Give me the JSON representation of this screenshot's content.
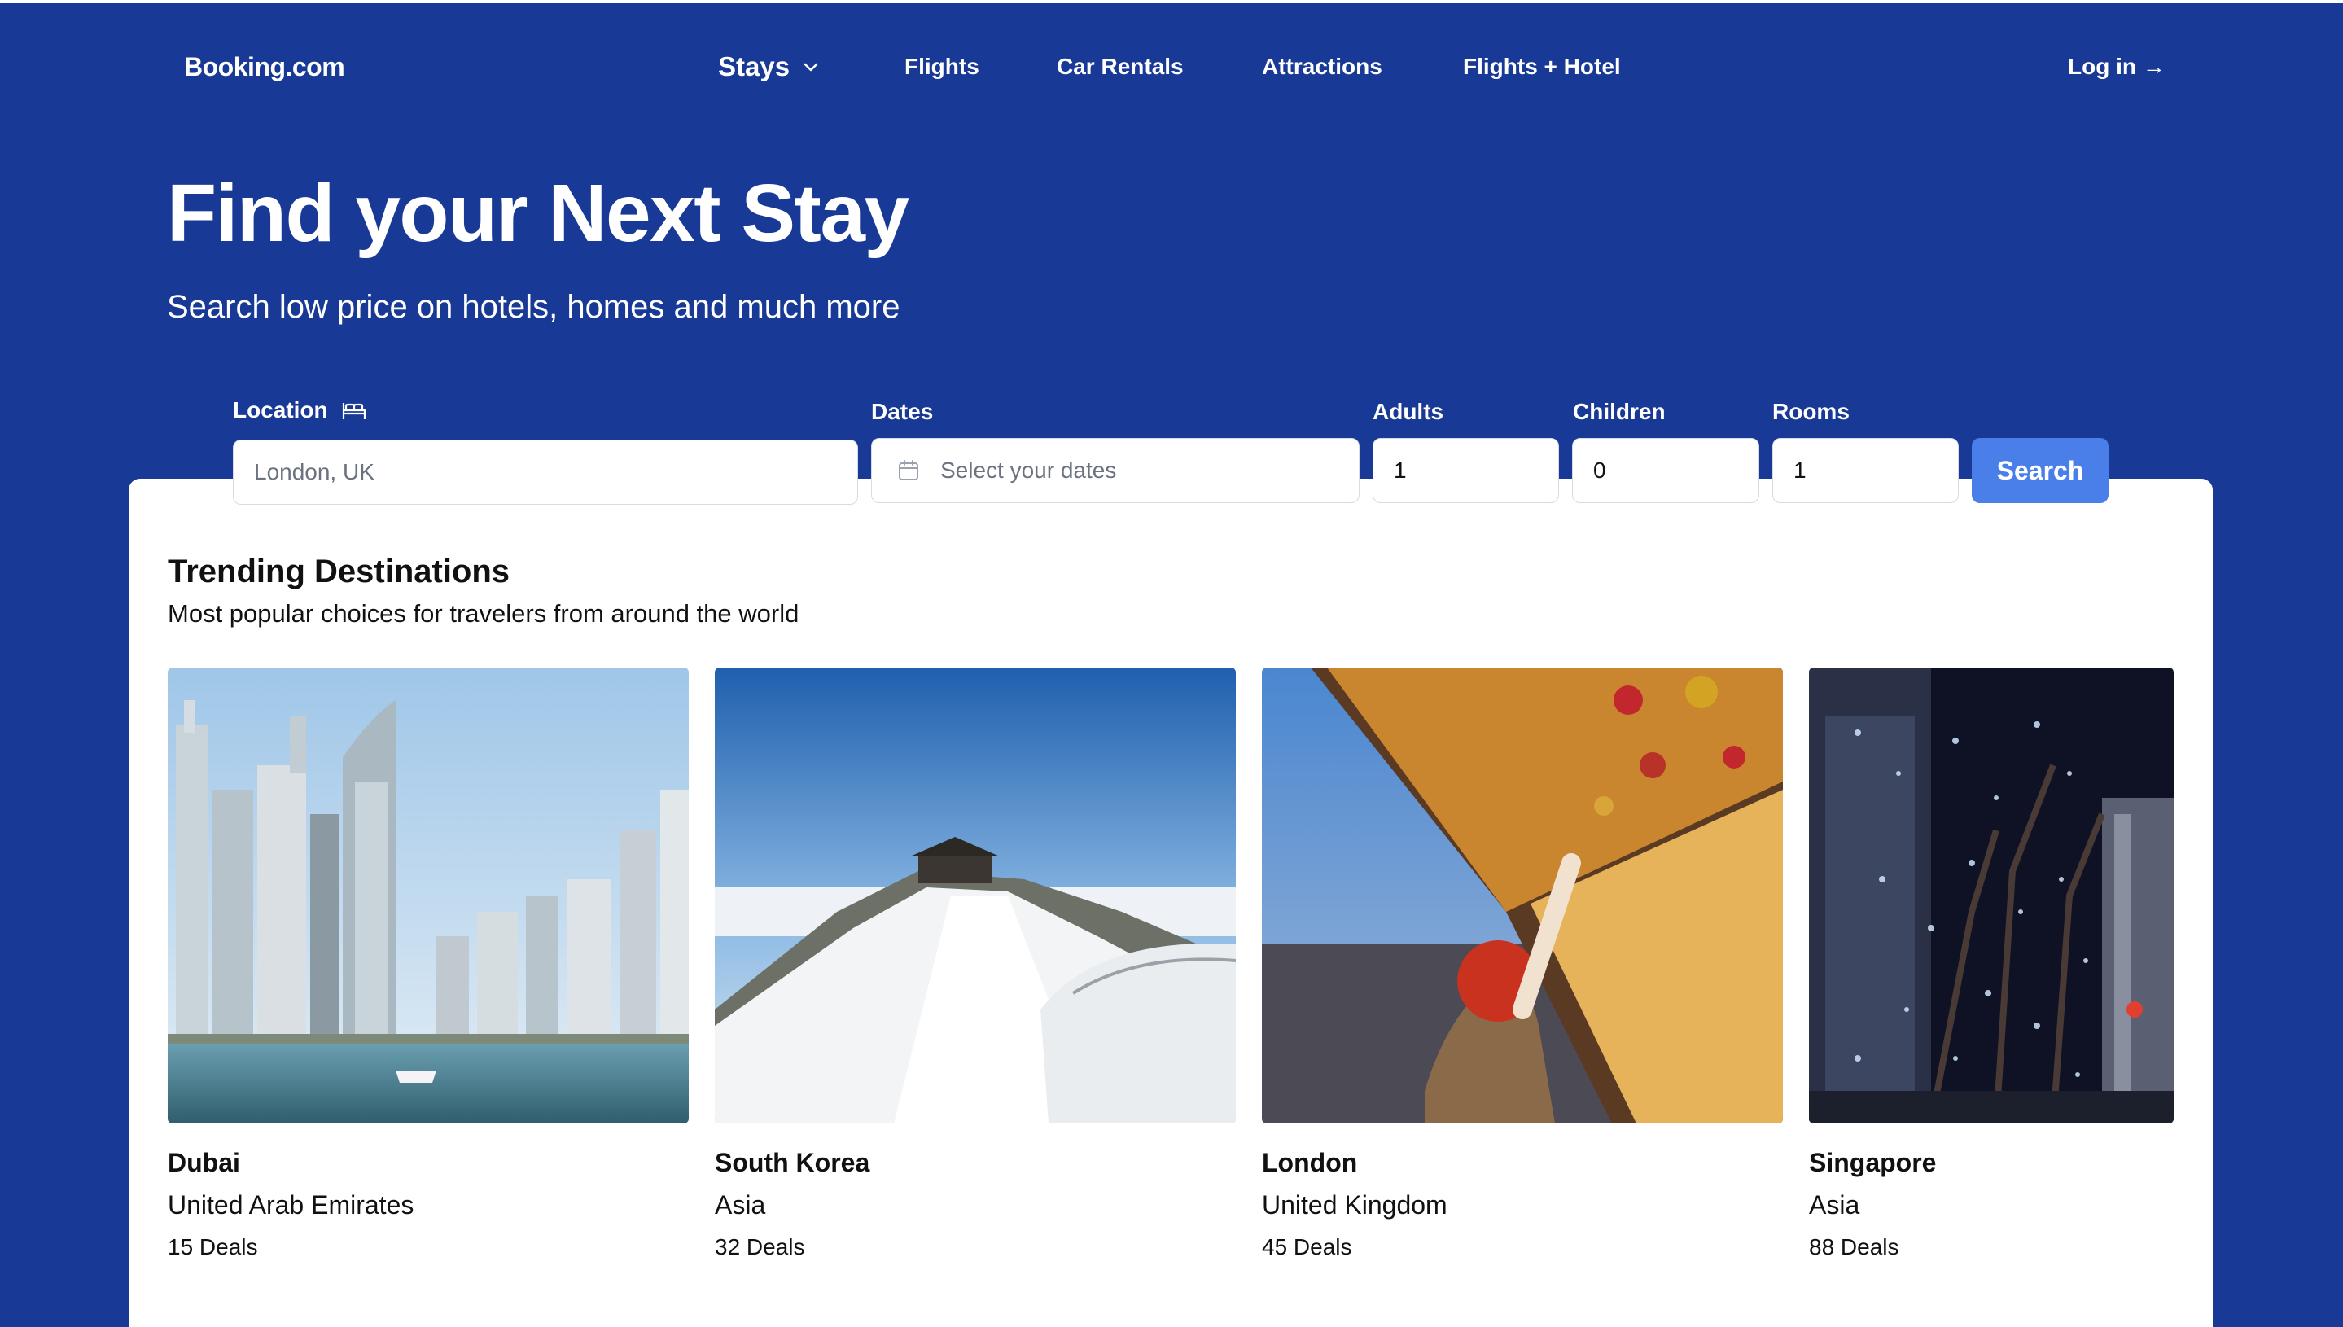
{
  "nav": {
    "logo": "Booking.com",
    "stays": "Stays",
    "flights": "Flights",
    "car_rentals": "Car Rentals",
    "attractions": "Attractions",
    "flights_hotel": "Flights + Hotel",
    "login": "Log in →"
  },
  "hero": {
    "title": "Find your Next Stay",
    "subtitle": "Search low price on hotels, homes and much more"
  },
  "search": {
    "location_label": "Location",
    "location_placeholder": "London, UK",
    "dates_label": "Dates",
    "dates_placeholder": "Select your dates",
    "adults_label": "Adults",
    "adults_value": "1",
    "children_label": "Children",
    "children_value": "0",
    "rooms_label": "Rooms",
    "rooms_value": "1",
    "search_button": "Search"
  },
  "trending": {
    "title": "Trending Destinations",
    "subtitle": "Most popular choices for travelers from around the world",
    "destinations": [
      {
        "name": "Dubai",
        "region": "United Arab Emirates",
        "deals": "15 Deals"
      },
      {
        "name": "South Korea",
        "region": "Asia",
        "deals": "32 Deals"
      },
      {
        "name": "London",
        "region": "United Kingdom",
        "deals": "45 Deals"
      },
      {
        "name": "Singapore",
        "region": "Asia",
        "deals": "88 Deals"
      }
    ]
  },
  "colors": {
    "brand_blue": "#183A96",
    "button_blue": "#4A7FEA"
  }
}
